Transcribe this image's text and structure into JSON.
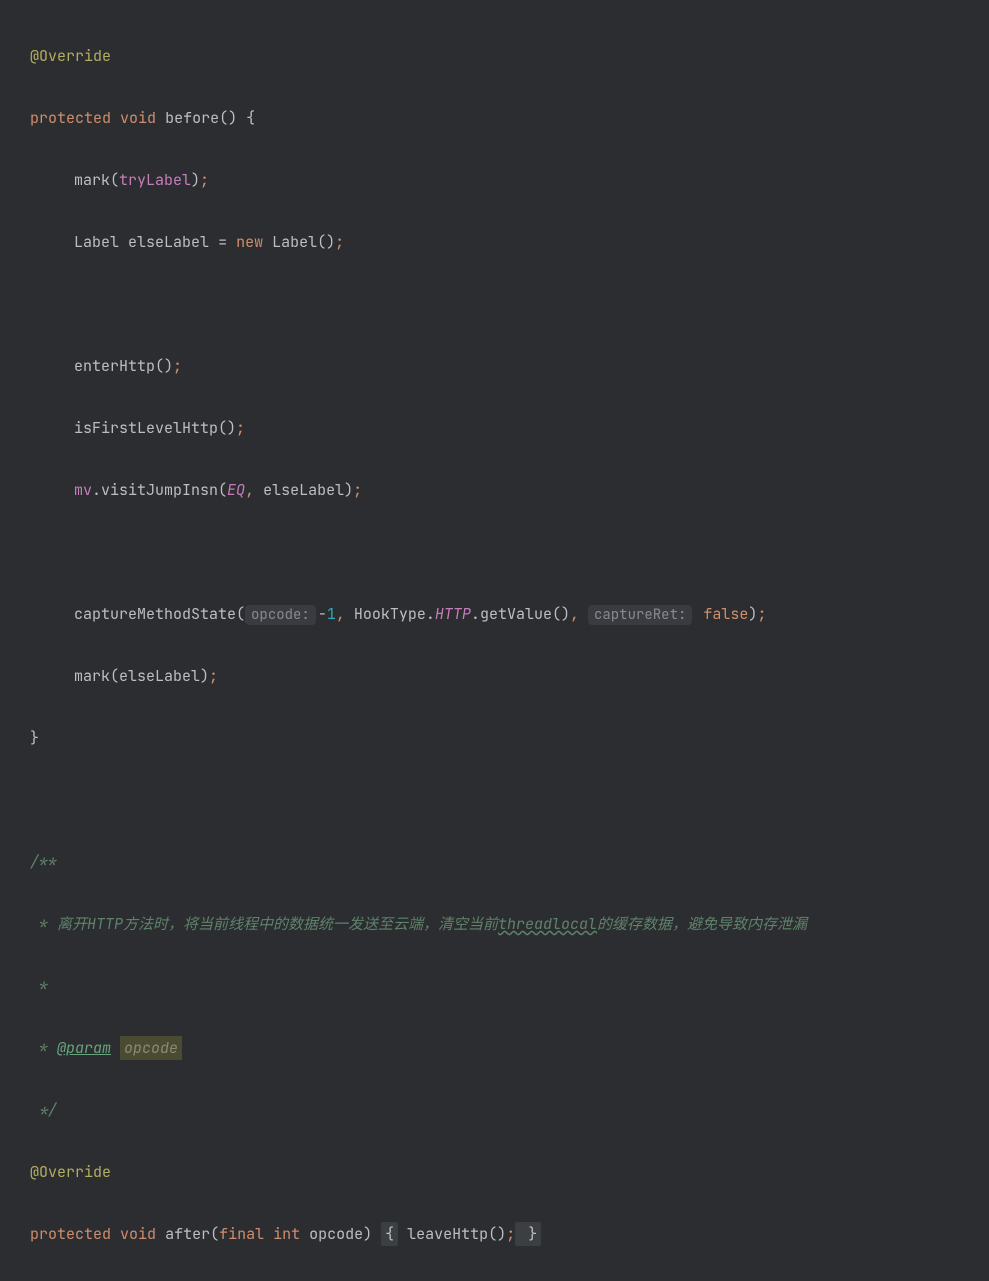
{
  "code": {
    "l1": {
      "annotation": "@Override"
    },
    "l2": {
      "kw1": "protected",
      "kw2": "void",
      "name": "before",
      "suffix": "() {"
    },
    "l3": {
      "call": "mark(",
      "arg": "tryLabel",
      "close": ")",
      "semi": ";"
    },
    "l4": {
      "type1": "Label",
      "var": "elseLabel",
      "eq": "=",
      "kw": "new",
      "ctor": "Label()",
      "semi": ";"
    },
    "l5": {
      "call": "enterHttp()",
      "semi": ";"
    },
    "l6": {
      "call": "isFirstLevelHttp()",
      "semi": ";"
    },
    "l7": {
      "obj": "mv",
      "dot": ".",
      "method": "visitJumpInsn(",
      "const": "EQ",
      "comma": ",",
      "arg2": " elseLabel)",
      "semi": ";"
    },
    "l8": {
      "call": "captureMethodState(",
      "hint1": "opcode:",
      "neg": "-",
      "one": "1",
      "comma1": ",",
      "mid": " HookType",
      "dot": ".",
      "http": "HTTP",
      "dot2": ".",
      "getval": "getValue()",
      "comma2": ",",
      "hint2": "captureRet:",
      "bool": "false",
      "close": ")",
      "semi": ";"
    },
    "l9": {
      "call": "mark(elseLabel)",
      "semi": ";"
    },
    "l10": {
      "brace": "}"
    },
    "c1": {
      "text": "/**"
    },
    "c2": {
      "prefix": " * ",
      "text1": "离开HTTP方法时，将当前线程中的数据统一发送至云端，清空当前",
      "wave": "threadlocal",
      "text2": "的缓存数据，避免导致内存泄漏"
    },
    "c3": {
      "text": " *"
    },
    "c4": {
      "prefix": " * ",
      "tag": "@param",
      "space": " ",
      "param": "opcode"
    },
    "c5": {
      "text": " */"
    },
    "l11": {
      "annotation": "@Override"
    },
    "l12": {
      "kw1": "protected",
      "kw2": "void",
      "name": "after",
      "open": "(",
      "kw3": "final",
      "kw4": "int",
      "param": " opcode) ",
      "brace1": "{",
      "body": " leaveHttp()",
      "semi": ";",
      "brace2": " }"
    }
  }
}
